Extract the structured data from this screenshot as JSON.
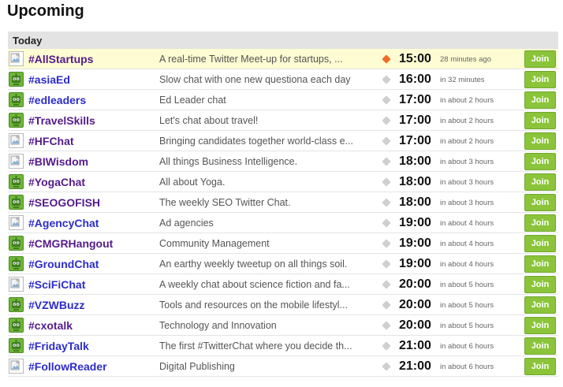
{
  "page": {
    "heading": "Upcoming"
  },
  "section": {
    "title": "Today"
  },
  "join_label": "Join",
  "colors": {
    "join": "#8bc43a",
    "live_dot": "#f26a2a",
    "idle_dot": "#cfcfcf",
    "highlight": "#fdfcd2",
    "header_bg": "#e3e3e3"
  },
  "chats": [
    {
      "name": "#AllStartups",
      "desc": "A real-time Twitter Meet-up for startups, ...",
      "time": "15:00",
      "rel": "28 minutes ago",
      "avatar": "broken-image-icon",
      "live": true,
      "visited": true
    },
    {
      "name": "#asiaEd",
      "desc": "Slow chat with one new questiona each day",
      "time": "16:00",
      "rel": "in 32 minutes",
      "avatar": "green-robot-icon",
      "live": false,
      "visited": false
    },
    {
      "name": "#edleaders",
      "desc": "Ed Leader chat",
      "time": "17:00",
      "rel": "in about 2 hours",
      "avatar": "green-robot-icon",
      "live": false,
      "visited": false
    },
    {
      "name": "#TravelSkills",
      "desc": "Let's chat about travel!",
      "time": "17:00",
      "rel": "in about 2 hours",
      "avatar": "green-robot-icon",
      "live": false,
      "visited": true
    },
    {
      "name": "#HFChat",
      "desc": "Bringing candidates together world-class e...",
      "time": "17:00",
      "rel": "in about 2 hours",
      "avatar": "broken-image-icon",
      "live": false,
      "visited": true
    },
    {
      "name": "#BIWisdom",
      "desc": "All things Business Intelligence.",
      "time": "18:00",
      "rel": "in about 3 hours",
      "avatar": "broken-image-icon",
      "live": false,
      "visited": true
    },
    {
      "name": "#YogaChat",
      "desc": "All about Yoga.",
      "time": "18:00",
      "rel": "in about 3 hours",
      "avatar": "green-robot-icon",
      "live": false,
      "visited": true
    },
    {
      "name": "#SEOGOFISH",
      "desc": "The weekly SEO Twitter Chat.",
      "time": "18:00",
      "rel": "in about 3 hours",
      "avatar": "green-robot-icon",
      "live": false,
      "visited": true
    },
    {
      "name": "#AgencyChat",
      "desc": "Ad agencies",
      "time": "19:00",
      "rel": "in about 4 hours",
      "avatar": "broken-image-icon",
      "live": false,
      "visited": false
    },
    {
      "name": "#CMGRHangout",
      "desc": "Community Management",
      "time": "19:00",
      "rel": "in about 4 hours",
      "avatar": "green-robot-icon",
      "live": false,
      "visited": true
    },
    {
      "name": "#GroundChat",
      "desc": "An earthy weekly tweetup on all things soil.",
      "time": "19:00",
      "rel": "in about 4 hours",
      "avatar": "green-robot-icon",
      "live": false,
      "visited": false
    },
    {
      "name": "#SciFiChat",
      "desc": "A weekly chat about science fiction and fa...",
      "time": "20:00",
      "rel": "in about 5 hours",
      "avatar": "broken-image-icon",
      "live": false,
      "visited": false
    },
    {
      "name": "#VZWBuzz",
      "desc": "Tools and resources on the mobile lifestyl...",
      "time": "20:00",
      "rel": "in about 5 hours",
      "avatar": "green-robot-icon",
      "live": false,
      "visited": false
    },
    {
      "name": "#cxotalk",
      "desc": "Technology and Innovation",
      "time": "20:00",
      "rel": "in about 5 hours",
      "avatar": "green-robot-icon",
      "live": false,
      "visited": true
    },
    {
      "name": "#FridayTalk",
      "desc": "The first #TwitterChat where you decide th...",
      "time": "21:00",
      "rel": "in about 6 hours",
      "avatar": "green-robot-icon",
      "live": false,
      "visited": false
    },
    {
      "name": "#FollowReader",
      "desc": "Digital Publishing",
      "time": "21:00",
      "rel": "in about 6 hours",
      "avatar": "broken-image-icon",
      "live": false,
      "visited": false
    }
  ]
}
